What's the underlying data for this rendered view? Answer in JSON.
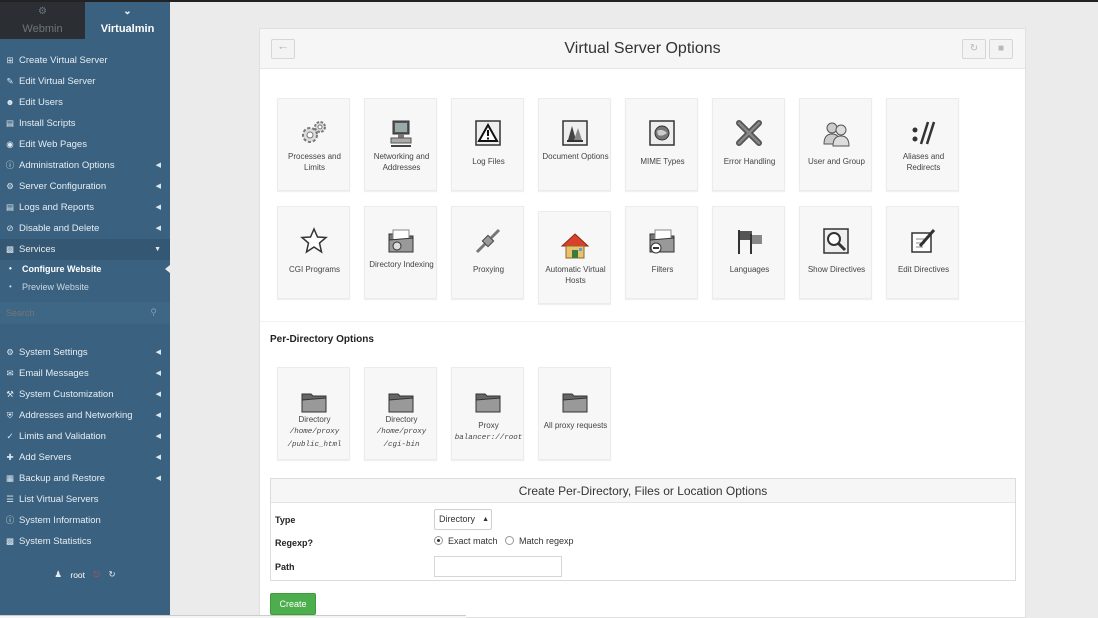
{
  "sidebar": {
    "tabs": [
      {
        "label": "Webmin",
        "icon": "webmin-icon"
      },
      {
        "label": "Virtualmin",
        "icon": "chevron-down-icon"
      }
    ],
    "items": [
      {
        "label": "Create Virtual Server",
        "icon": "plus-square-icon"
      },
      {
        "label": "Edit Virtual Server",
        "icon": "edit-icon"
      },
      {
        "label": "Edit Users",
        "icon": "users-icon"
      },
      {
        "label": "Install Scripts",
        "icon": "script-icon"
      },
      {
        "label": "Edit Web Pages",
        "icon": "globe-icon"
      },
      {
        "label": "Administration Options",
        "icon": "info-icon"
      },
      {
        "label": "Server Configuration",
        "icon": "cogs-icon"
      },
      {
        "label": "Logs and Reports",
        "icon": "document-icon"
      },
      {
        "label": "Disable and Delete",
        "icon": "ban-icon"
      },
      {
        "label": "Services",
        "icon": "sitemap-icon"
      }
    ],
    "services_sub": [
      {
        "label": "Configure Website"
      },
      {
        "label": "Preview Website"
      }
    ],
    "search_placeholder": "Search",
    "items2": [
      {
        "label": "System Settings",
        "icon": "gear-icon"
      },
      {
        "label": "Email Messages",
        "icon": "envelope-icon"
      },
      {
        "label": "System Customization",
        "icon": "wrench-icon"
      },
      {
        "label": "Addresses and Networking",
        "icon": "shield-icon"
      },
      {
        "label": "Limits and Validation",
        "icon": "check-icon"
      },
      {
        "label": "Add Servers",
        "icon": "plus-icon"
      },
      {
        "label": "Backup and Restore",
        "icon": "save-icon"
      },
      {
        "label": "List Virtual Servers",
        "icon": "list-icon"
      },
      {
        "label": "System Information",
        "icon": "info-circle-icon"
      },
      {
        "label": "System Statistics",
        "icon": "bar-chart-icon"
      }
    ],
    "footer": {
      "user": "root"
    }
  },
  "main": {
    "title": "Virtual Server Options",
    "tiles_row1": [
      {
        "label": "Processes and Limits",
        "icon": "gears-icon"
      },
      {
        "label": "Networking and Addresses",
        "icon": "network-computer-icon"
      },
      {
        "label": "Log Files",
        "icon": "warning-sign-icon"
      },
      {
        "label": "Document Options",
        "icon": "document-options-icon"
      },
      {
        "label": "MIME Types",
        "icon": "mime-types-icon"
      },
      {
        "label": "Error Handling",
        "icon": "error-x-icon"
      },
      {
        "label": "User and Group",
        "icon": "user-group-icon"
      },
      {
        "label": "Aliases and Redirects",
        "icon": "aliases-icon"
      }
    ],
    "tiles_row2": [
      {
        "label": "CGI Programs",
        "icon": "star-icon"
      },
      {
        "label": "Directory Indexing",
        "icon": "directory-indexing-icon"
      },
      {
        "label": "Proxying",
        "icon": "plug-icon"
      },
      {
        "label": "Automatic Virtual Hosts",
        "icon": "house-icon"
      },
      {
        "label": "Filters",
        "icon": "filter-folder-icon"
      },
      {
        "label": "Languages",
        "icon": "flags-icon"
      },
      {
        "label": "Show Directives",
        "icon": "magnifier-icon"
      },
      {
        "label": "Edit Directives",
        "icon": "edit-pencil-icon"
      }
    ],
    "per_directory_title": "Per-Directory Options",
    "per_directory": [
      {
        "label": "Directory",
        "detail": "/home/proxy /public_html",
        "icon": "folder-icon"
      },
      {
        "label": "Directory",
        "detail": "/home/proxy /cgi-bin",
        "icon": "folder-icon"
      },
      {
        "label": "Proxy",
        "detail": "balancer://root",
        "icon": "folder-icon"
      },
      {
        "label": "All proxy requests",
        "detail": "",
        "icon": "folder-icon"
      }
    ],
    "form": {
      "title": "Create Per-Directory, Files or Location Options",
      "type_label": "Type",
      "type_value": "Directory",
      "regexp_label": "Regexp?",
      "regexp_option_exact": "Exact match",
      "regexp_option_match": "Match regexp",
      "path_label": "Path",
      "path_value": ""
    },
    "create_button": "Create"
  },
  "colors": {
    "sidebar_bg": "#3a6280",
    "create_button": "#4cae4c",
    "logout": "#e04848"
  }
}
